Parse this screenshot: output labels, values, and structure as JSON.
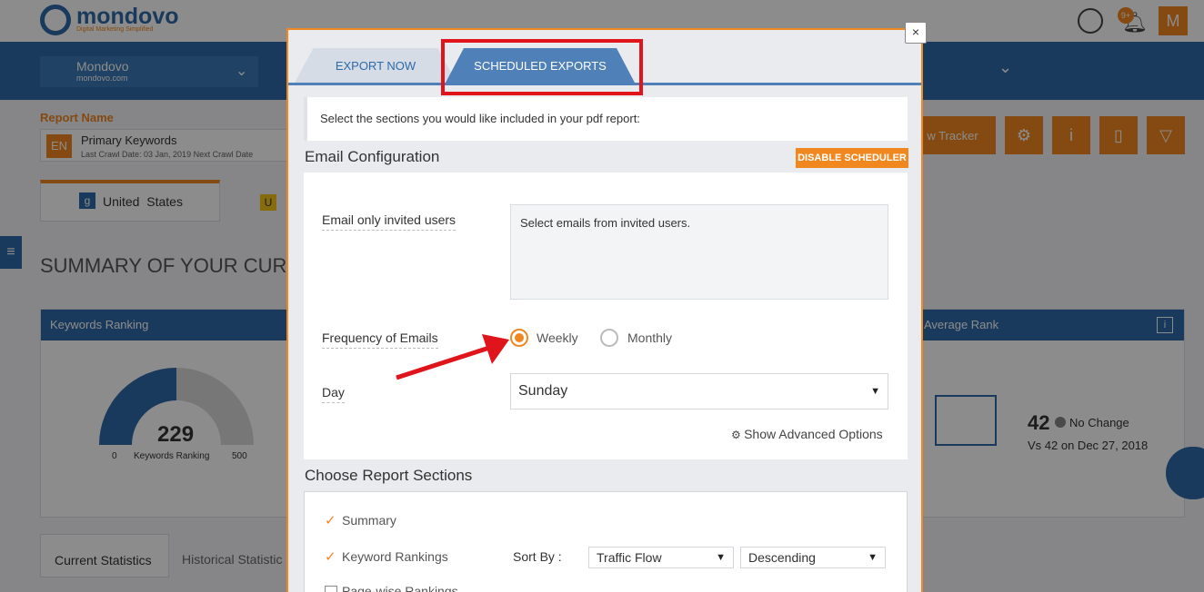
{
  "app": {
    "logo_name": "mondovo",
    "logo_tagline": "Digital Marketing Simplified",
    "notif_badge": "9+",
    "user_initial": "M"
  },
  "project": {
    "name": "Mondovo",
    "domain": "mondovo.com"
  },
  "report": {
    "label": "Report Name",
    "lang": "EN",
    "name": "Primary Keywords",
    "crawl": "Last Crawl Date: 03 Jan, 2019   Next Crawl Date"
  },
  "background": {
    "country_tab": "United  States",
    "bing_tab_letter": "U",
    "summary_title": "SUMMARY OF YOUR CUR",
    "tracker_btn": "w Tracker",
    "kw_card_title": "Keywords Ranking",
    "gauge_value": "229",
    "gauge_min": "0",
    "gauge_label": "Keywords Ranking",
    "gauge_max": "500",
    "avg_card_title": "Average Rank",
    "avg_value": "42",
    "avg_change": "No Change",
    "avg_vs": "Vs 42 on Dec 27, 2018",
    "tab_current": "Current Statistics",
    "tab_historical": "Historical Statistic"
  },
  "modal": {
    "close": "×",
    "tabs": [
      {
        "label": "EXPORT NOW"
      },
      {
        "label": "SCHEDULED EXPORTS"
      }
    ],
    "intro": "Select the sections you would like included in your pdf report:",
    "email_config_title": "Email Configuration",
    "disable_scheduler": "DISABLE SCHEDULER",
    "email_only_label": "Email only invited users",
    "email_select_placeholder": "Select emails from invited users.",
    "frequency_label": "Frequency of Emails",
    "frequency_options": [
      {
        "label": "Weekly",
        "selected": true
      },
      {
        "label": "Monthly",
        "selected": false
      }
    ],
    "day_label": "Day",
    "day_value": "Sunday",
    "advanced": "Show Advanced Options",
    "sections_title": "Choose Report Sections",
    "sections": [
      {
        "label": "Summary",
        "checked": true
      },
      {
        "label": "Keyword Rankings",
        "checked": true
      },
      {
        "label": "Page-wise Rankings",
        "checked": false
      }
    ],
    "sort_by_label": "Sort By :",
    "sort_field": "Traffic Flow",
    "sort_order": "Descending"
  },
  "colors": {
    "accent": "#f0871f",
    "primary": "#2e6aa8",
    "highlight": "#e0141b"
  }
}
